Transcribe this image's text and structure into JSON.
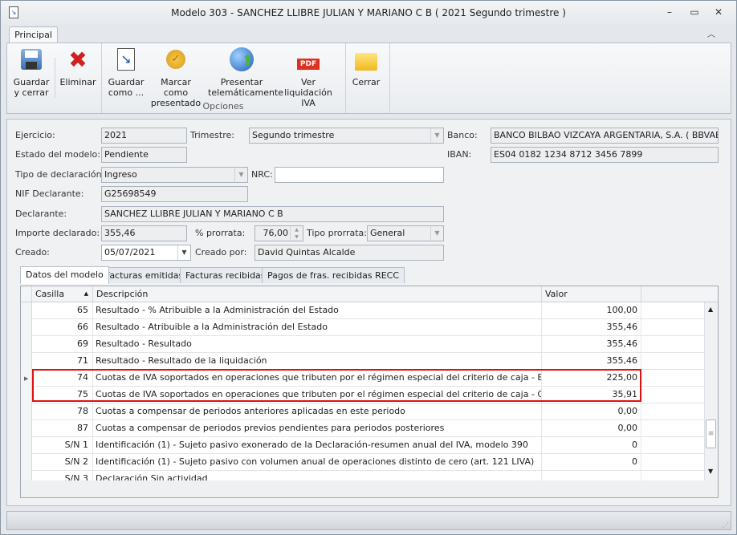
{
  "window": {
    "title": "Modelo 303 - SANCHEZ LLIBRE JULIAN Y MARIANO C B ( 2021 Segundo trimestre )"
  },
  "ribbon": {
    "tab": "Principal",
    "group_label": "Opciones",
    "buttons": [
      {
        "label1": "Guardar",
        "label2": "y cerrar",
        "icon": "floppy-icon"
      },
      {
        "label1": "Eliminar",
        "label2": "",
        "icon": "delete-x-icon"
      },
      {
        "label1": "Guardar",
        "label2": "como ...",
        "icon": "save-as-icon"
      },
      {
        "label1": "Marcar como",
        "label2": "presentado",
        "icon": "seal-icon"
      },
      {
        "label1": "Presentar",
        "label2": "telemáticamente",
        "icon": "upload-globe-icon"
      },
      {
        "label1": "Ver liquidación",
        "label2": "IVA",
        "icon": "pdf-icon"
      },
      {
        "label1": "Cerrar",
        "label2": "",
        "icon": "folder-close-icon"
      }
    ]
  },
  "form": {
    "ejercicio_label": "Ejercicio:",
    "ejercicio": "2021",
    "trimestre_label": "Trimestre:",
    "trimestre": "Segundo trimestre",
    "banco_label": "Banco:",
    "banco": "BANCO BILBAO VIZCAYA ARGENTARIA, S.A. ( BBVAESMM",
    "estado_label": "Estado del modelo:",
    "estado": "Pendiente",
    "iban_label": "IBAN:",
    "iban": "ES04 0182 1234 8712 3456 7899",
    "tipo_label": "Tipo de declaración:",
    "tipo": "Ingreso",
    "nrc_label": "NRC:",
    "nrc": "",
    "nif_label": "NIF Declarante:",
    "nif": "G25698549",
    "declarante_label": "Declarante:",
    "declarante": "SANCHEZ LLIBRE JULIAN Y MARIANO C B",
    "importe_label": "Importe declarado:",
    "importe": "355,46",
    "prorrata_label": "% prorrata:",
    "prorrata": "76,00",
    "tipo_prorrata_label": "Tipo prorrata:",
    "tipo_prorrata": "General",
    "creado_label": "Creado:",
    "creado": "05/07/2021",
    "creado_por_label": "Creado por:",
    "creado_por": "David Quintas Alcalde"
  },
  "tabs": [
    "Datos del modelo",
    "Facturas emitidas",
    "Facturas recibidas",
    "Pagos de fras. recibidas RECC"
  ],
  "grid": {
    "columns": [
      "Casilla",
      "Descripción",
      "Valor"
    ],
    "rows": [
      {
        "casilla": "65",
        "desc": "Resultado - % Atribuible a la Administración del Estado",
        "valor": "100,00"
      },
      {
        "casilla": "66",
        "desc": "Resultado - Atribuible a la Administración del Estado",
        "valor": "355,46"
      },
      {
        "casilla": "69",
        "desc": "Resultado - Resultado",
        "valor": "355,46"
      },
      {
        "casilla": "71",
        "desc": "Resultado - Resultado de la liquidación",
        "valor": "355,46"
      },
      {
        "casilla": "74",
        "desc": "Cuotas de IVA soportados en operaciones que tributen por el régimen especial del criterio de caja - Base Imponible",
        "valor": "225,00"
      },
      {
        "casilla": "75",
        "desc": "Cuotas de IVA soportados en operaciones que tributen por el régimen especial del criterio de caja - Cuota",
        "valor": "35,91"
      },
      {
        "casilla": "78",
        "desc": "Cuotas a compensar de periodos anteriores aplicadas en este periodo",
        "valor": "0,00"
      },
      {
        "casilla": "87",
        "desc": "Cuotas a compensar de periodos previos pendientes para periodos posteriores",
        "valor": "0,00"
      },
      {
        "casilla": "S/N 1",
        "desc": "Identificación (1) - Sujeto pasivo exonerado de la Declaración-resumen anual del IVA, modelo 390",
        "valor": "0"
      },
      {
        "casilla": "S/N 2",
        "desc": "Identificación (1) - Sujeto pasivo con volumen anual de operaciones distinto de cero (art. 121 LIVA)",
        "valor": "0"
      },
      {
        "casilla": "S/N 3",
        "desc": "Declaración Sin actividad",
        "valor": ""
      }
    ]
  }
}
